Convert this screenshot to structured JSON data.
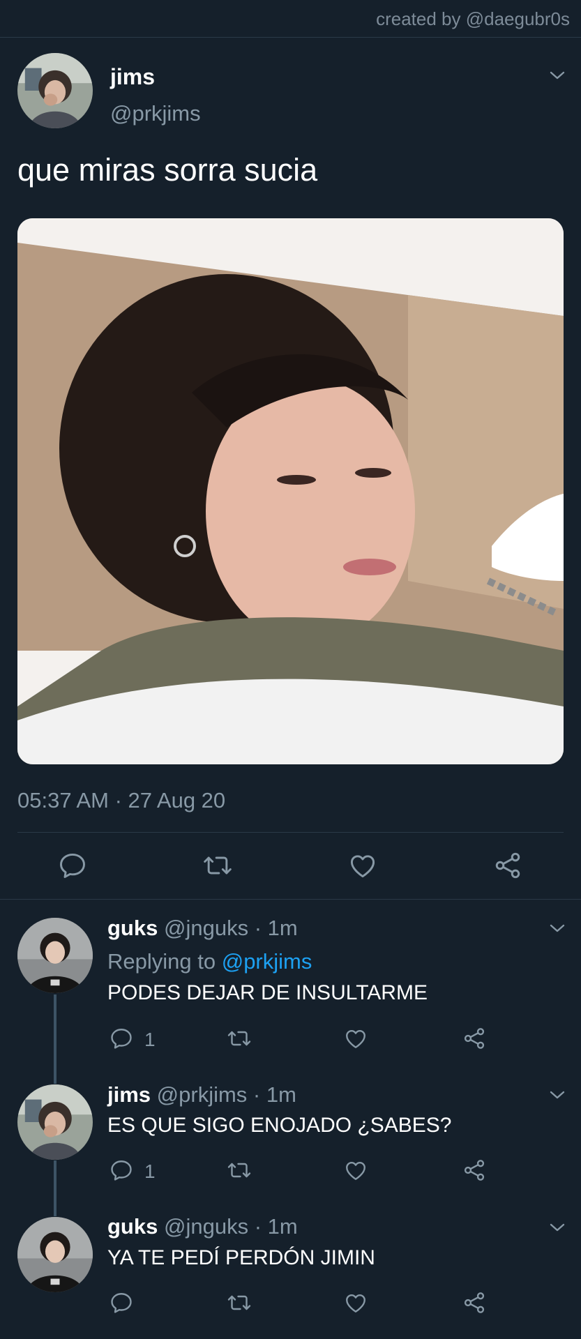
{
  "credit": "created by @daegubr0s",
  "tweet": {
    "name": "jims",
    "handle": "@prkjims",
    "text": "que miras sorra sucia",
    "timestamp": "05:37 AM · 27 Aug 20"
  },
  "replies": [
    {
      "name": "guks",
      "handle": "@jnguks",
      "time": "1m",
      "replying_label": "Replying to",
      "replying_to": "@prkjims",
      "text": "PODES DEJAR DE INSULTARME",
      "reply_count": "1"
    },
    {
      "name": "jims",
      "handle": "@prkjims",
      "time": "1m",
      "text": "ES QUE SIGO ENOJADO ¿SABES?",
      "reply_count": "1"
    },
    {
      "name": "guks",
      "handle": "@jnguks",
      "time": "1m",
      "text": "YA TE PEDÍ PERDÓN JIMIN"
    }
  ],
  "colors": {
    "background": "#15202b",
    "secondary_text": "#8899a6",
    "accent": "#1da1f2",
    "divider": "#2b3a48"
  },
  "icons": {
    "reply": "reply-icon",
    "retweet": "retweet-icon",
    "like": "heart-icon",
    "share": "share-icon",
    "more": "chevron-down-icon"
  }
}
